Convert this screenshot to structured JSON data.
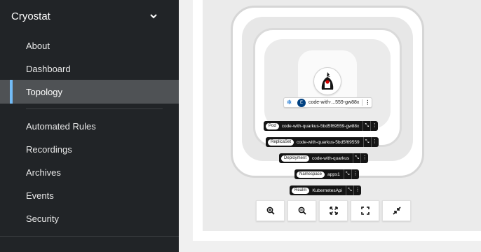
{
  "sidebar": {
    "app_title": "Cryostat",
    "items": [
      {
        "label": "About"
      },
      {
        "label": "Dashboard"
      },
      {
        "label": "Topology",
        "active": true
      },
      {
        "label": "Automated Rules"
      },
      {
        "label": "Recordings"
      },
      {
        "label": "Archives"
      },
      {
        "label": "Events"
      },
      {
        "label": "Security"
      }
    ]
  },
  "topology": {
    "node": {
      "label": "code-with-...559-gw88x",
      "badge": "E"
    },
    "groups": [
      {
        "kind": "Pod",
        "name": "code-with-quarkus-5bd5f69559-gw88x"
      },
      {
        "kind": "ReplicaSet",
        "name": "code-with-quarkus-5bd5f69559"
      },
      {
        "kind": "Deployment",
        "name": "code-with-quarkus"
      },
      {
        "kind": "Namespace",
        "name": "apps1"
      },
      {
        "kind": "Realm",
        "name": "KubernetesApi"
      }
    ],
    "zoom_controls": [
      "zoom-in-icon",
      "zoom-out-icon",
      "fit-to-screen-icon",
      "expand-icon",
      "collapse-icon"
    ]
  },
  "colors": {
    "sidebar_bg": "#212427",
    "active_item_bg": "#4f5255",
    "active_indicator": "#73bcf7",
    "label_bg": "#151515"
  }
}
